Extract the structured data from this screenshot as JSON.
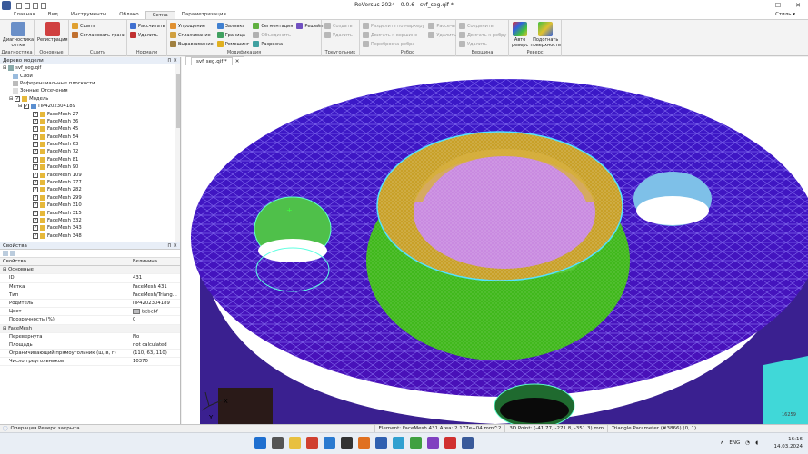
{
  "app": {
    "title": "ReVersus 2024 - 0.0.6 - svf_seg.qif *",
    "style_label": "Стиль"
  },
  "menu": {
    "tabs": [
      "Главная",
      "Вид",
      "Инструменты",
      "Облако",
      "Сетка",
      "Параметризация"
    ]
  },
  "ribbon": {
    "diag": {
      "btn": "Диагностика сетки",
      "label": "Диагностика"
    },
    "main": {
      "btn": "Регистрация",
      "label": "Основные"
    },
    "sew": {
      "a": "Сшить",
      "b": "Согласовать грани",
      "label": "Сшить"
    },
    "normals": {
      "a": "Рассчитать",
      "b": "Удалить",
      "label": "Нормали"
    },
    "modif": {
      "a": "Упрощение",
      "b": "Сглаживание",
      "c": "Выравнивание",
      "d": "Заливка",
      "e": "Граница",
      "f": "Ремешинг",
      "g": "Сегментация",
      "h": "Объединить",
      "i": "Разрезка",
      "j": "Решейпинг",
      "label": "Модификация"
    },
    "tri": {
      "a": "Создать",
      "b": "Удалить",
      "label": "Треугольник"
    },
    "edge": {
      "a": "Разделить по маркеру",
      "b": "Двигать к вершине",
      "c": "Переброска ребра",
      "d": "Рассечь",
      "e": "Удалить",
      "label": "Ребро"
    },
    "vertex": {
      "a": "Соединить",
      "b": "Двигать к ребру",
      "c": "Удалить",
      "label": "Вершина"
    },
    "reverse": {
      "a": "Авто реверс",
      "b": "Подогнать поверхность",
      "label": "Реверс"
    }
  },
  "model_tree": {
    "header": "Дерево модели",
    "root": "svf_seg.qif",
    "layers": "Слои",
    "refplanes": "Референциальные плоскости",
    "zones": "Зонные Отсечения",
    "model": "Модель",
    "part": "ПР4202304189",
    "items": [
      "FaceMesh 27",
      "FaceMesh 36",
      "FaceMesh 45",
      "FaceMesh 54",
      "FaceMesh 63",
      "FaceMesh 72",
      "FaceMesh 81",
      "FaceMesh 90",
      "FaceMesh 109",
      "FaceMesh 277",
      "FaceMesh 282",
      "FaceMesh 299",
      "FaceMesh 310",
      "FaceMesh 315",
      "FaceMesh 332",
      "FaceMesh 343",
      "FaceMesh 348"
    ]
  },
  "properties": {
    "header": "Свойства",
    "col_prop": "Свойство",
    "col_val": "Величина",
    "cat_main": "Основные",
    "cat_facemesh": "FaceMesh",
    "rows": [
      {
        "k": "ID",
        "v": "431"
      },
      {
        "k": "Метка",
        "v": "FaceMesh 431"
      },
      {
        "k": "Тип",
        "v": "FaceMesh/Triang..."
      },
      {
        "k": "Родитель",
        "v": "ПР4202304189"
      },
      {
        "k": "Цвет",
        "v": "bcbcbf"
      },
      {
        "k": "Прозрачность (%)",
        "v": "0"
      }
    ],
    "rows2": [
      {
        "k": "Перевернута",
        "v": "No"
      },
      {
        "k": "Площадь",
        "v": "not calculated"
      },
      {
        "k": "Ограничивающий прямоугольник (ш, в, г)",
        "v": "(110, 63, 110)"
      },
      {
        "k": "Число треугольников",
        "v": "10370"
      }
    ]
  },
  "viewport": {
    "tab": "svf_seg.qif *",
    "axis_x": "X",
    "axis_y": "Y",
    "corner": "16259"
  },
  "status": {
    "left": "Операция Реверс закрыта.",
    "element": "Element: FaceMesh 431 Area: 2.177e+04 mm^2",
    "point": "3D Point: (-41.77, -271.8, -351.3) mm",
    "tri": "Triangle Parameter (#3866) (0, 1)"
  },
  "taskbar": {
    "lang": "ENG",
    "time": "16:16",
    "date": "14.03.2024"
  },
  "colors": {
    "flange": "#3a10c8",
    "ring": "#c8a020",
    "inner": "#d08ae0",
    "green": "#3db81a",
    "hole": "#7ec0e8"
  }
}
